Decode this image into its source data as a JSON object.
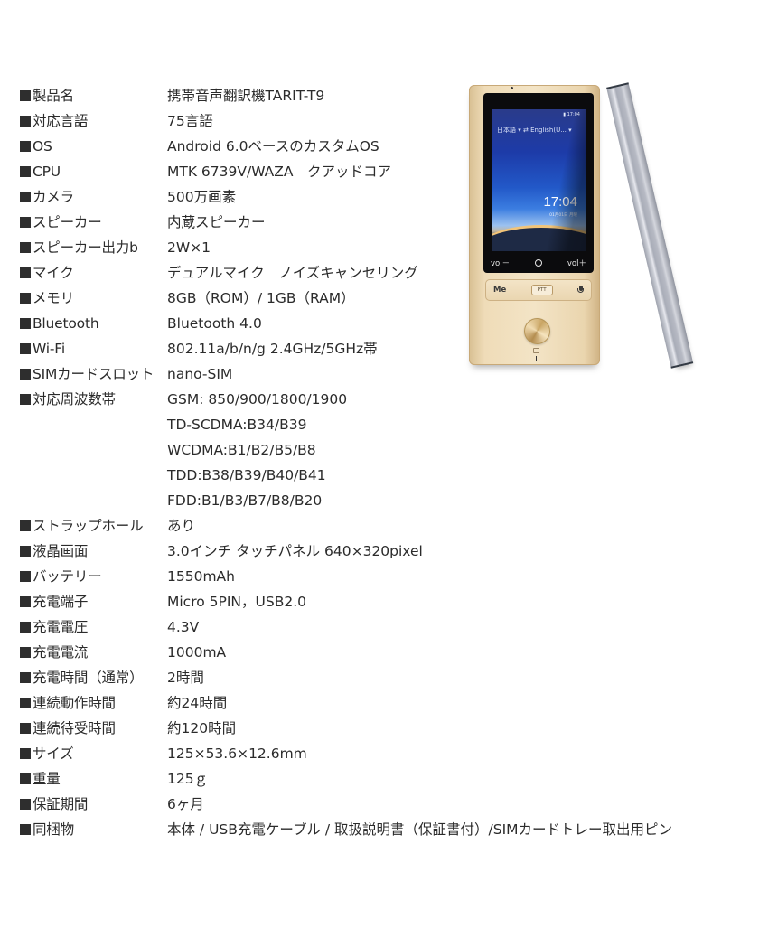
{
  "specs": [
    {
      "label": "製品名",
      "value": "携帯音声翻訳機TARIT-T9"
    },
    {
      "label": "対応言語",
      "value": "75言語"
    },
    {
      "label": "OS",
      "value": "Android 6.0ベースのカスタムOS"
    },
    {
      "label": "CPU",
      "value": "MTK 6739V/WAZA　クアッドコア"
    },
    {
      "label": "カメラ",
      "value": "500万画素"
    },
    {
      "label": "スピーカー",
      "value": "内蔵スピーカー"
    },
    {
      "label": "スピーカー出力b",
      "value": "2W×1"
    },
    {
      "label": "マイク",
      "value": "デュアルマイク　ノイズキャンセリング"
    },
    {
      "label": "メモリ",
      "value": "8GB（ROM）/ 1GB（RAM）"
    },
    {
      "label": "Bluetooth",
      "value": "Bluetooth 4.0"
    },
    {
      "label": "Wi-Fi",
      "value": "802.11a/b/n/g 2.4GHz/5GHz帯"
    },
    {
      "label": "SIMカードスロット",
      "value": "nano-SIM"
    },
    {
      "label": "対応周波数帯",
      "value": "GSM: 850/900/1800/1900"
    },
    {
      "label": "",
      "value": "TD-SCDMA:B34/B39"
    },
    {
      "label": "",
      "value": "WCDMA:B1/B2/B5/B8"
    },
    {
      "label": "",
      "value": "TDD:B38/B39/B40/B41"
    },
    {
      "label": "",
      "value": "FDD:B1/B3/B7/B8/B20"
    },
    {
      "label": "ストラップホール",
      "value": "あり"
    },
    {
      "label": "液晶画面",
      "value": "3.0インチ タッチパネル 640×320pixel"
    },
    {
      "label": "バッテリー",
      "value": "1550mAh"
    },
    {
      "label": "充電端子",
      "value": "Micro 5PIN，USB2.0"
    },
    {
      "label": "充電電圧",
      "value": "4.3V"
    },
    {
      "label": "充電電流",
      "value": "1000mA"
    },
    {
      "label": "充電時間（通常）",
      "value": "2時間"
    },
    {
      "label": "連続動作時間",
      "value": "約24時間"
    },
    {
      "label": "連続待受時間",
      "value": "約120時間"
    },
    {
      "label": "サイズ",
      "value": "125×53.6×12.6mm"
    },
    {
      "label": "重量",
      "value": "125ｇ"
    },
    {
      "label": "保証期間",
      "value": "6ヶ月"
    },
    {
      "label": "同梱物",
      "value": "本体 / USB充電ケーブル / 取扱説明書（保証書付）/SIMカードトレー取出用ピン"
    }
  ],
  "device": {
    "status_time": "17:04",
    "source_language": "日本語",
    "swap_symbol": "⇄",
    "target_language": "English(U...",
    "dropdown_marker": "▾",
    "clock": "17:04",
    "date": "01月01日 月曜",
    "vol_down": "vol－",
    "vol_up": "vol＋",
    "me_key": "Me",
    "ptt_key": "PTT"
  }
}
